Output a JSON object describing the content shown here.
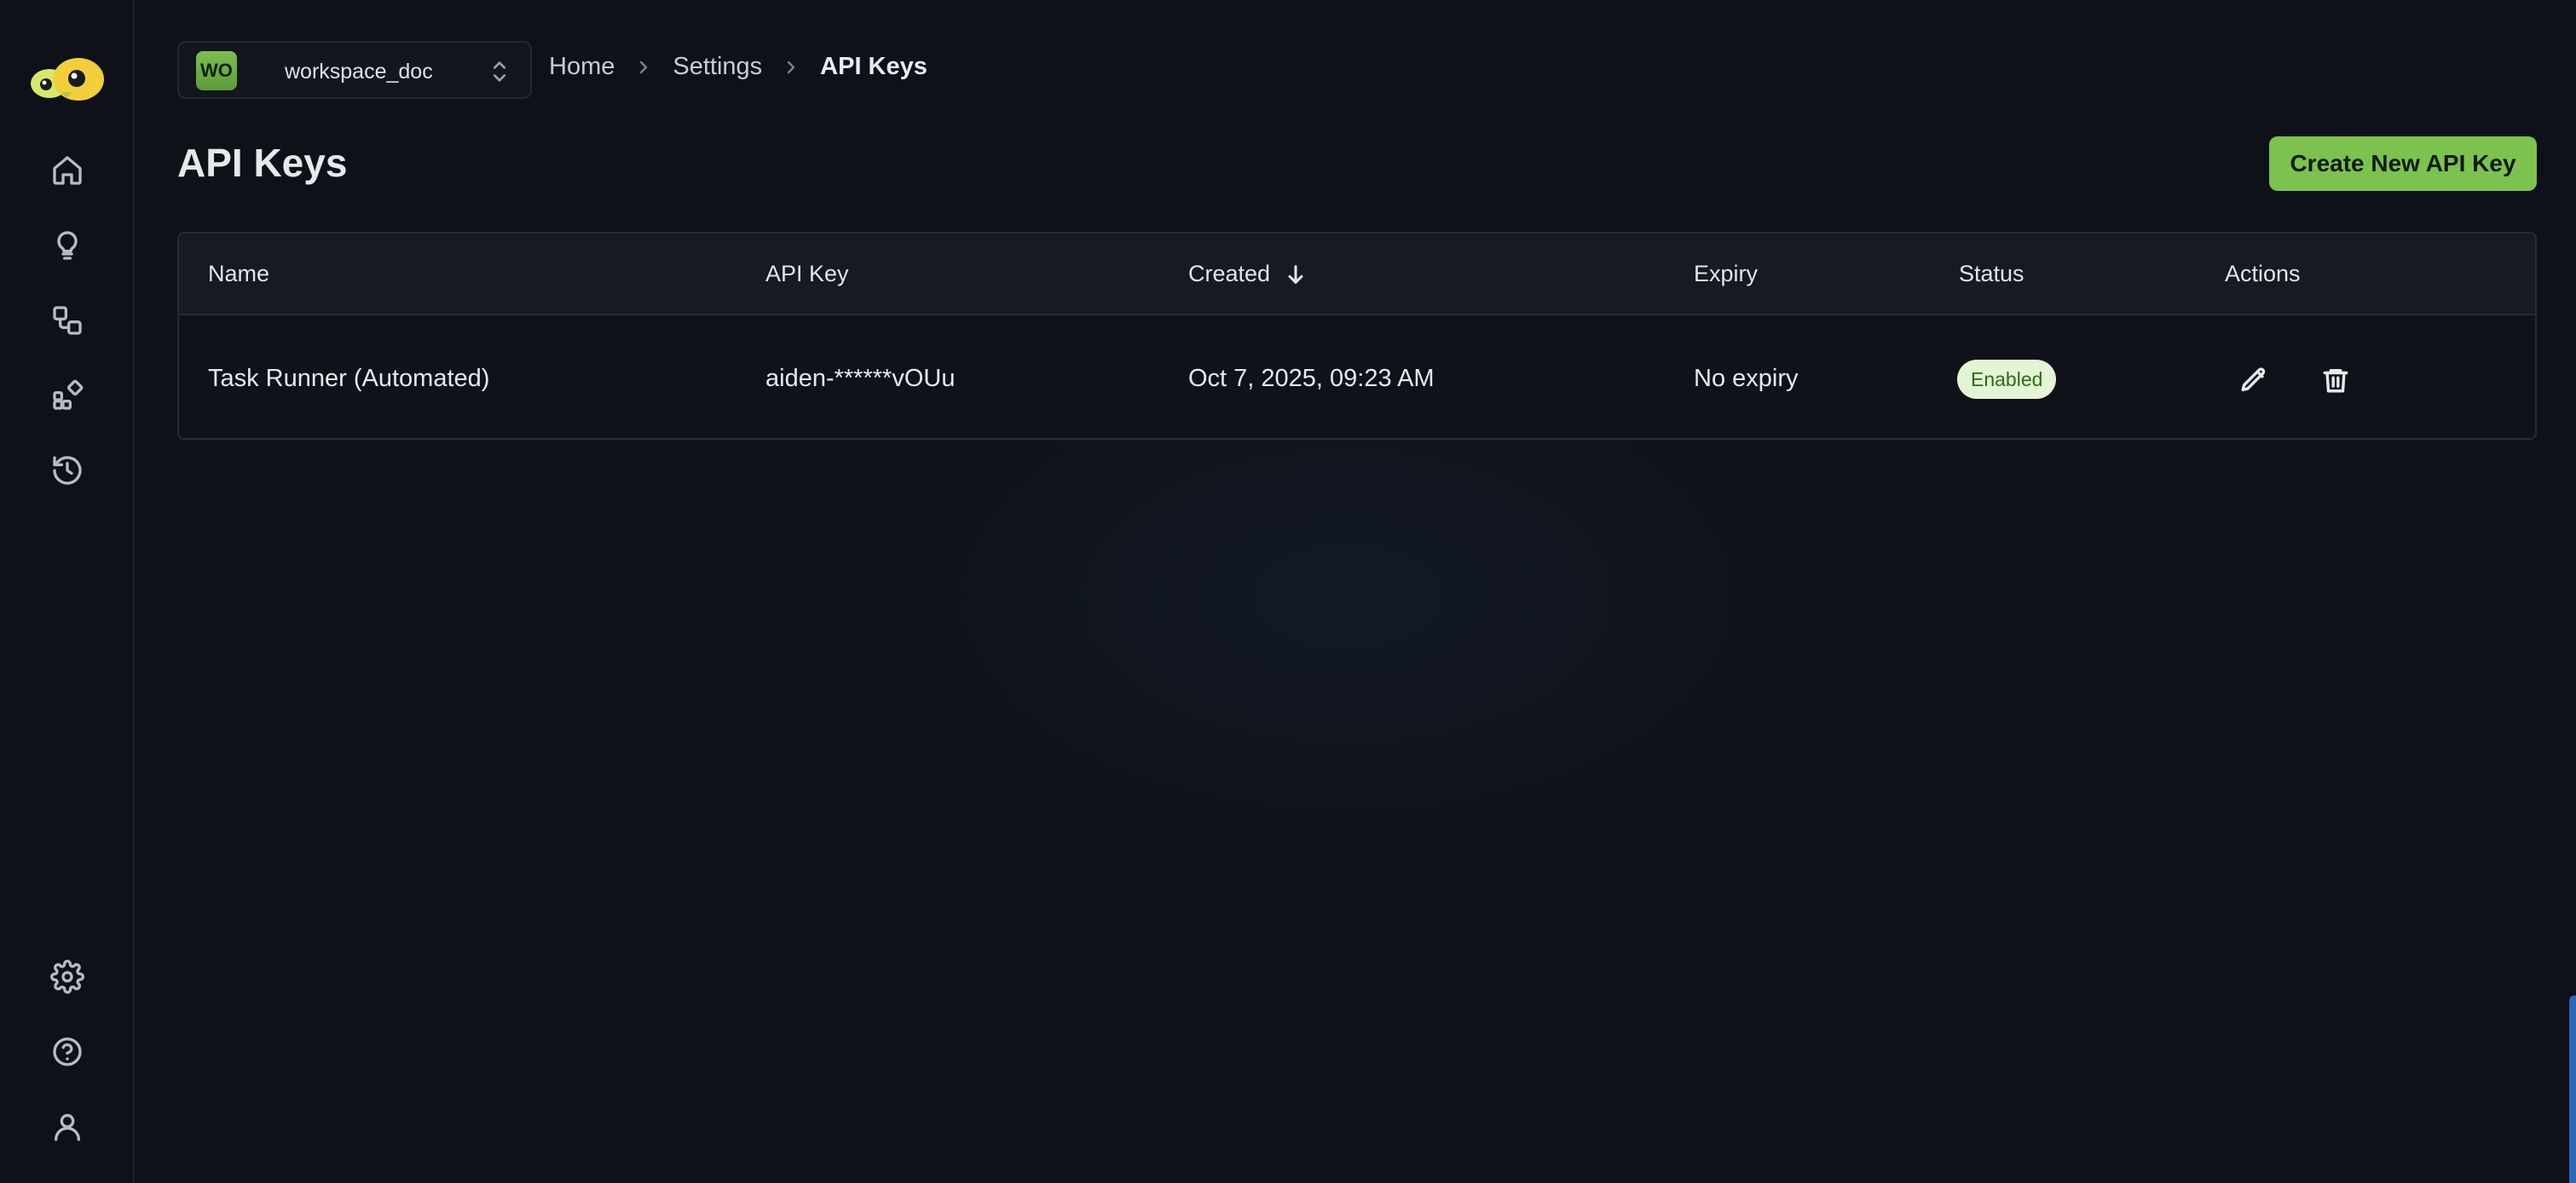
{
  "sidebar": {
    "top_icons": [
      "home-icon",
      "lightbulb-icon",
      "workflow-icon",
      "apps-icon",
      "history-icon"
    ],
    "bottom_icons": [
      "gear-icon",
      "help-icon",
      "user-icon"
    ]
  },
  "workspace": {
    "badge": "WO",
    "name": "workspace_doc"
  },
  "breadcrumb": {
    "home": "Home",
    "settings": "Settings",
    "current": "API Keys"
  },
  "page": {
    "title": "API Keys",
    "create_button": "Create New API Key"
  },
  "table": {
    "columns": {
      "name": "Name",
      "api_key": "API Key",
      "created": "Created",
      "expiry": "Expiry",
      "status": "Status",
      "actions": "Actions"
    },
    "rows": [
      {
        "name": "Task Runner (Automated)",
        "api_key": "aiden-******vOUu",
        "created": "Oct 7, 2025, 09:23 AM",
        "expiry": "No expiry",
        "status": "Enabled"
      }
    ]
  },
  "colors": {
    "accent": "#7cc24f",
    "background": "#0e1117",
    "status_enabled_bg": "#e3f5d4",
    "status_enabled_text": "#2f6a17"
  }
}
